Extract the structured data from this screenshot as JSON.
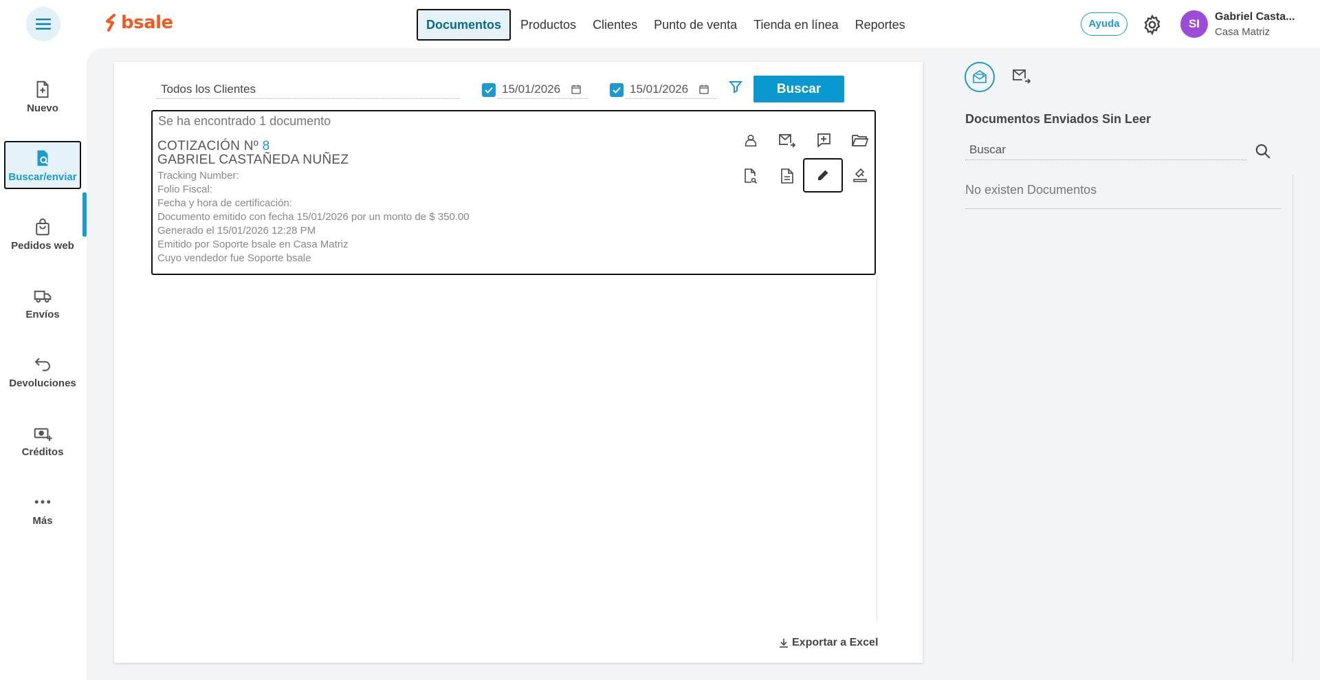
{
  "header": {
    "logo_text": "bsale",
    "nav": [
      "Documentos",
      "Productos",
      "Clientes",
      "Punto de venta",
      "Tienda en línea",
      "Reportes"
    ],
    "active_nav": "Documentos",
    "help_label": "Ayuda",
    "avatar_initials": "SI",
    "user_name": "Gabriel Casta...",
    "user_branch": "Casa Matriz"
  },
  "sidebar": {
    "items": [
      {
        "label": "Nuevo",
        "icon": "new-document-icon"
      },
      {
        "label": "Buscar/enviar",
        "icon": "search-document-icon"
      },
      {
        "label": "Pedidos web",
        "icon": "shopping-bag-icon"
      },
      {
        "label": "Envíos",
        "icon": "truck-icon"
      },
      {
        "label": "Devoluciones",
        "icon": "return-arrow-icon"
      },
      {
        "label": "Créditos",
        "icon": "credit-money-icon"
      },
      {
        "label": "Más",
        "icon": "more-dots-icon"
      }
    ],
    "active": "Buscar/enviar"
  },
  "filters": {
    "client": "Todos los Clientes",
    "date_from": "15/01/2026",
    "date_to": "15/01/2026",
    "date_from_checked": true,
    "date_to_checked": true,
    "search_label": "Buscar"
  },
  "results": {
    "count_text": "Se ha encontrado 1 documento",
    "document": {
      "title_prefix": "COTIZACIÓN Nº",
      "number": "8",
      "client": "GABRIEL CASTAÑEDA NUÑEZ",
      "lines": [
        "Tracking Number:",
        "Folio Fiscal:",
        "Fecha y hora de certificación:",
        "Documento emitido con fecha 15/01/2026 por un monto de $ 350.00",
        "Generado el 15/01/2026 12:28 PM",
        "Emitido por Soporte bsale en Casa Matriz",
        "Cuyo vendedor fue Soporte bsale"
      ]
    },
    "actions": [
      "client-icon",
      "send-mail-icon",
      "add-comment-icon",
      "open-folder-icon",
      "document-link-icon",
      "document-icon",
      "edit-pencil-icon",
      "stamp-icon"
    ]
  },
  "export_label": "Exportar a Excel",
  "right_panel": {
    "title": "Documentos Enviados Sin Leer",
    "search_placeholder": "Buscar",
    "empty_text": "No existen Documentos"
  },
  "colors": {
    "accent": "#1a9ad1",
    "brand": "#f05a22",
    "avatar": "#9b4dd8"
  }
}
